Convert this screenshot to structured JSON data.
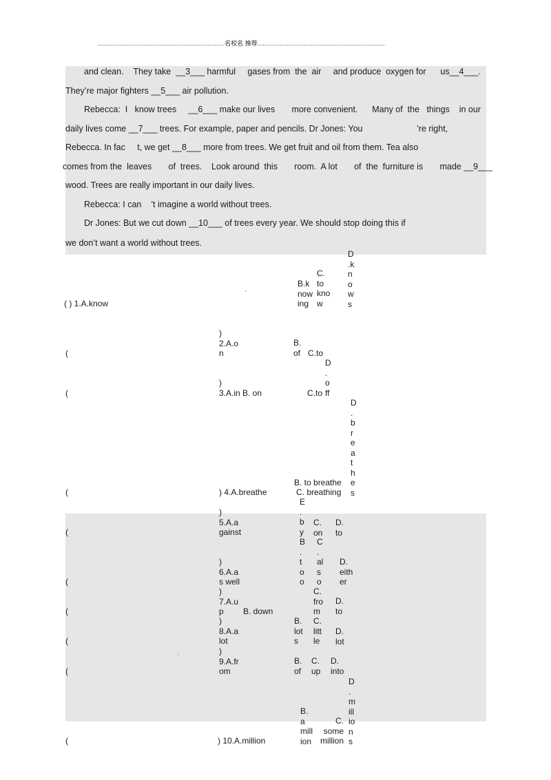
{
  "header": {
    "text": "名校名 推荐"
  },
  "passage": {
    "lines": [
      "and clean.    They take  __3___ harmful     gases from  the  air     and produce  oxygen for      us__4___.",
      "They’re major fighters __5___ air pollution.",
      "Rebecca:  I   know trees     __6___ make our lives       more convenient.      Many of  the   things    in our",
      "daily lives come __7___ trees. For example, paper and pencils. Dr Jones: You",
      "’re right,",
      "Rebecca. In fac     t, we get __8___ more from trees. We get fruit and oil from them. Tea also",
      "comes from the  leaves       of  trees.    Look around  this       room.  A lot       of  the  furniture is       made __9___",
      "wood. Trees are really important in our daily lives.",
      "Rebecca: I can    ’t imagine a world without trees.",
      "Dr Jones: But we cut down __10___ of trees every year. We should stop doing this if",
      "we don’t want a world without trees."
    ]
  },
  "questions": [
    {
      "num": "1",
      "stem": "( ) 1.A.know",
      "B": "B.k\nnow\ning",
      "C": "C.\nto\nkno\nw",
      "D": "D\n.k\nn\no\nw\ns"
    },
    {
      "num": "2",
      "open": "(",
      "stem": ")\n2.A.o\nn",
      "B": "B.\nof",
      "C": "C.to",
      "D": "D\n.\no\nff"
    },
    {
      "num": "3",
      "open": "(",
      "stem": ")\n3.A.in",
      "B": "B. on",
      "C": "C.to"
    },
    {
      "num": "4",
      "open": "(",
      "stem": ") 4.A.breathe",
      "B": "B. to breathe",
      "C": "C. breathing",
      "D": "D\n.\nb\nr\ne\na\nt\nh\ne\ns"
    },
    {
      "num": "5",
      "open": "(",
      "stem": ")\n5.A.a\ngainst",
      "B": "E\n.\nb\ny",
      "C": "C.\non",
      "D": "D.\nto"
    },
    {
      "num": "6",
      "open": "(",
      "stem": ")\n6.A.a\ns well",
      "B": "B\n.\nt\no\no",
      "C": "C\n.\nal\ns\no",
      "D": "D.\neith\ner"
    },
    {
      "num": "7",
      "open": "(",
      "stem": ")\n7.A.u\np",
      "B": "B. down",
      "C": "C.\nfro\nm",
      "D": "D.\nto"
    },
    {
      "num": "8",
      "open": "(",
      "stem": ")\n8.A.a\nlot",
      "B": "B.\nlot\ns",
      "C": "C.\nlitt\nle",
      "D": "D.\nlot"
    },
    {
      "num": "9",
      "open": "(",
      "stem": ")\n9.A.fr\nom",
      "B": "B.\nof",
      "C": "C.\nup",
      "D": "D.\ninto"
    },
    {
      "num": "10",
      "open": "(",
      "stem": ") 10.A.million",
      "B": "B.\na\nmill\nion",
      "C": "C.\nsome\nmillion",
      "D": "D\n.\nm\nill\nio\nn\ns"
    }
  ]
}
